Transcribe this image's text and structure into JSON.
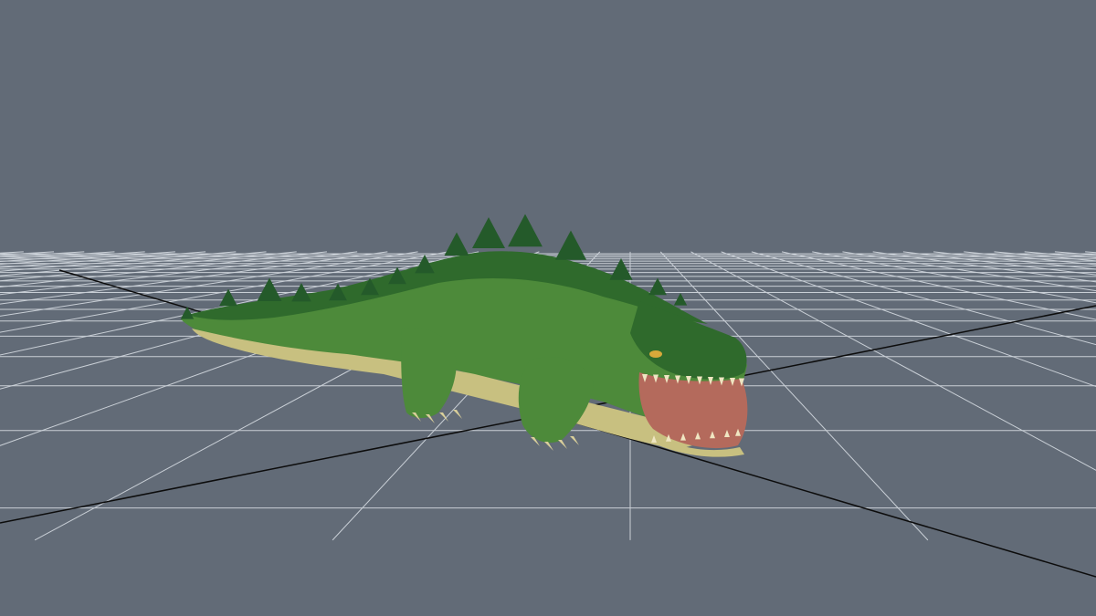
{
  "viewport": {
    "background": "#626b77",
    "grid_color": "#c9cfd6",
    "axis_color": "#0c0c0c"
  },
  "model": {
    "name": "crocodile",
    "colors": {
      "back": "#2f6a2c",
      "back_dark": "#1d4a1e",
      "side": "#4d8a3a",
      "belly": "#c8c080",
      "spike": "#245a2a",
      "mouth": "#b46a5c",
      "teeth": "#efe6c2",
      "claws": "#d9cf9a"
    }
  }
}
